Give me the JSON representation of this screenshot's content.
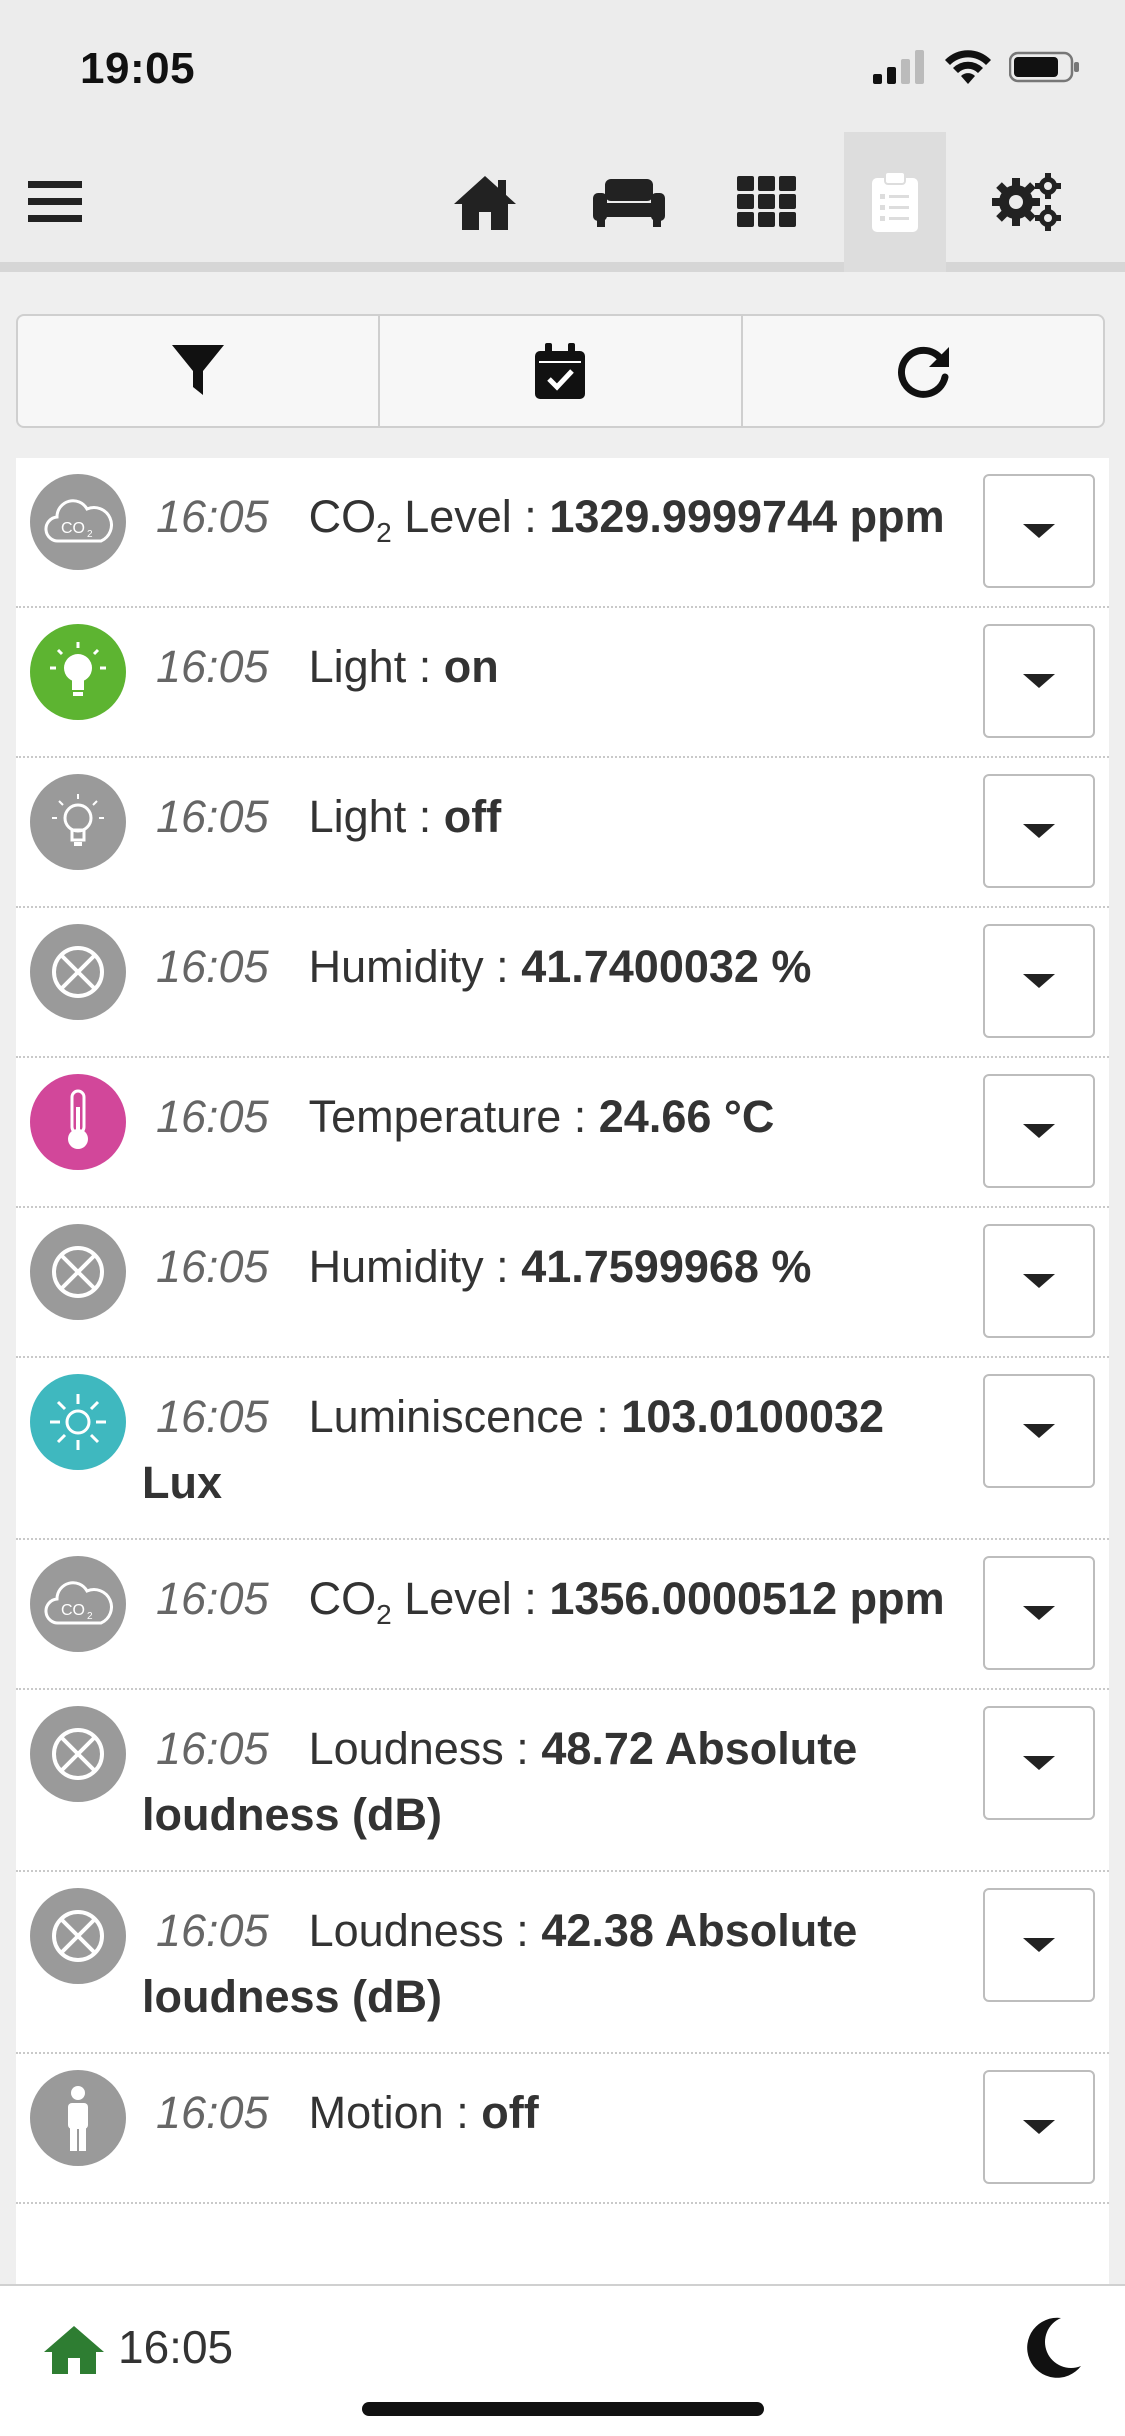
{
  "status_bar": {
    "time": "19:05"
  },
  "header": {
    "nav": [
      {
        "name": "menu-icon"
      },
      {
        "name": "home-icon"
      },
      {
        "name": "sofa-icon"
      },
      {
        "name": "grid-icon"
      },
      {
        "name": "clipboard-icon",
        "active": true
      },
      {
        "name": "gears-icon"
      }
    ]
  },
  "toolbar": {
    "buttons": [
      "filter-icon",
      "calendar-check-icon",
      "refresh-icon"
    ]
  },
  "log": [
    {
      "time": "16:05",
      "label_pre": "CO",
      "label_sub": "2",
      "label_post": " Level",
      "sep": " : ",
      "value": "1329.9999744 ppm",
      "icon": "co2-icon",
      "color": "#9a9a9a"
    },
    {
      "time": "16:05",
      "label_pre": "Light",
      "sep": " : ",
      "value": "on",
      "icon": "bulb-on-icon",
      "color": "#5db431"
    },
    {
      "time": "16:05",
      "label_pre": "Light",
      "sep": " : ",
      "value": "off",
      "icon": "bulb-off-icon",
      "color": "#9a9a9a"
    },
    {
      "time": "16:05",
      "label_pre": "Humidity",
      "sep": " : ",
      "value": "41.7400032 %",
      "icon": "sensor-icon",
      "color": "#9a9a9a"
    },
    {
      "time": "16:05",
      "label_pre": "Temperature",
      "sep": " : ",
      "value": "24.66 °C",
      "icon": "thermometer-icon",
      "color": "#d2479a"
    },
    {
      "time": "16:05",
      "label_pre": "Humidity",
      "sep": " : ",
      "value": "41.7599968 %",
      "icon": "sensor-icon",
      "color": "#9a9a9a"
    },
    {
      "time": "16:05",
      "label_pre": "Luminiscence",
      "sep": " : ",
      "value": "103.0100032 Lux",
      "icon": "sun-icon",
      "color": "#3fb8bf"
    },
    {
      "time": "16:05",
      "label_pre": "CO",
      "label_sub": "2",
      "label_post": " Level",
      "sep": " : ",
      "value": "1356.0000512 ppm",
      "icon": "co2-icon",
      "color": "#9a9a9a"
    },
    {
      "time": "16:05",
      "label_pre": "Loudness",
      "sep": " : ",
      "value": "48.72 Absolute loudness (dB)",
      "icon": "sensor-icon",
      "color": "#9a9a9a"
    },
    {
      "time": "16:05",
      "label_pre": "Loudness",
      "sep": " : ",
      "value": "42.38 Absolute loudness (dB)",
      "icon": "sensor-icon",
      "color": "#9a9a9a"
    },
    {
      "time": "16:05",
      "label_pre": "Motion",
      "sep": " : ",
      "value": "off",
      "icon": "person-icon",
      "color": "#9a9a9a"
    }
  ],
  "footer": {
    "time": "16:05",
    "home_color": "#2e7d32"
  }
}
